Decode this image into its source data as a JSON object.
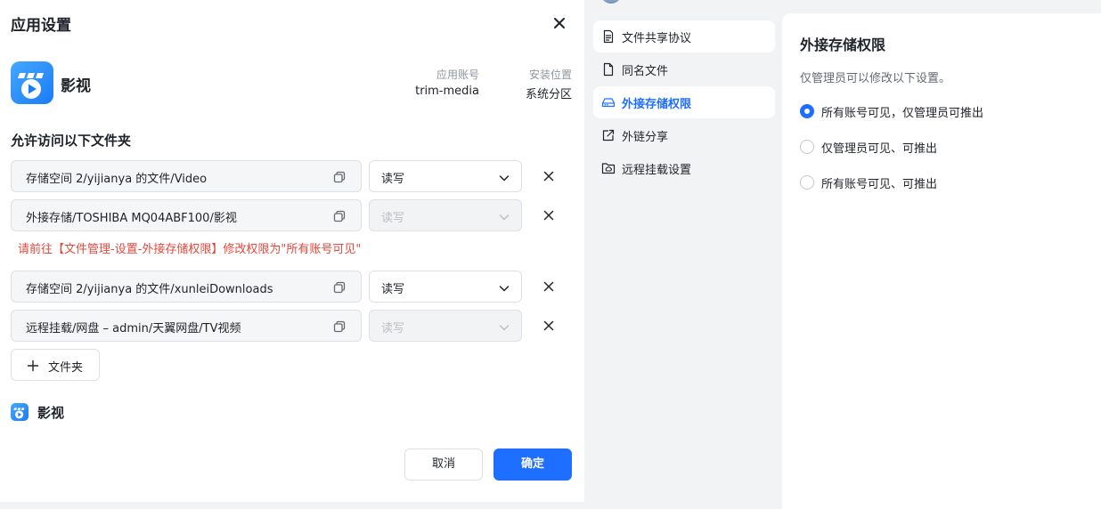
{
  "dialog": {
    "title": "应用设置",
    "app": {
      "name": "影视",
      "account_label": "应用账号",
      "account_value": "trim-media",
      "location_label": "安装位置",
      "location_value": "系统分区"
    },
    "folders_title": "允许访问以下文件夹",
    "folders": [
      {
        "path": "存储空间 2/yijianya 的文件/Video",
        "permission": "读写",
        "disabled": false
      },
      {
        "path": "外接存储/TOSHIBA MQ04ABF100/影视",
        "permission": "读写",
        "disabled": true
      },
      {
        "path": "存储空间 2/yijianya 的文件/xunleiDownloads",
        "permission": "读写",
        "disabled": false
      },
      {
        "path": "远程挂载/网盘 – admin/天翼网盘/TV视频",
        "permission": "读写",
        "disabled": true
      }
    ],
    "warning": "请前往【文件管理-设置-外接存储权限】修改权限为\"所有账号可见\"",
    "add_folder_label": "文件夹",
    "footer_app_name": "影视",
    "cancel_label": "取消",
    "confirm_label": "确定"
  },
  "settings": {
    "nav": [
      {
        "label": "文件共享协议",
        "icon": "document-icon",
        "active": false
      },
      {
        "label": "同名文件",
        "icon": "file-icon",
        "active": false
      },
      {
        "label": "外接存储权限",
        "icon": "external-drive-icon",
        "active": true
      },
      {
        "label": "外链分享",
        "icon": "share-icon",
        "active": false
      },
      {
        "label": "远程挂载设置",
        "icon": "remote-folder-icon",
        "active": false
      }
    ],
    "content": {
      "title": "外接存储权限",
      "description": "仅管理员可以修改以下设置。",
      "options": [
        {
          "label": "所有账号可见，仅管理员可推出",
          "checked": true
        },
        {
          "label": "仅管理员可见、可推出",
          "checked": false
        },
        {
          "label": "所有账号可见、可推出",
          "checked": false
        }
      ]
    }
  },
  "colors": {
    "accent": "#1e6fff",
    "warning": "#e5483c",
    "app_icon": "#1a7cf5"
  }
}
